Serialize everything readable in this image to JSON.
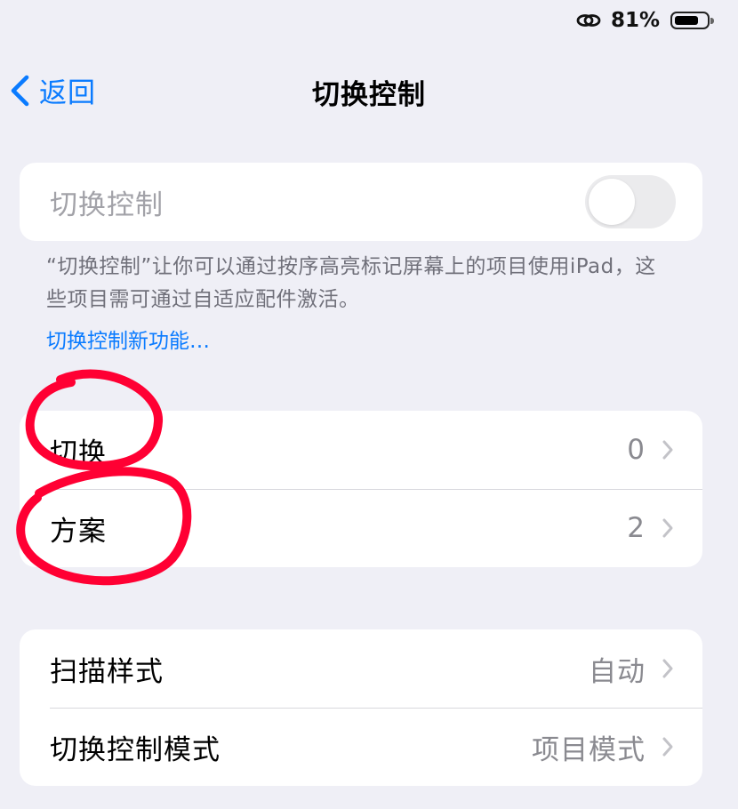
{
  "status_bar": {
    "link_icon": "link-icon",
    "battery_percent": "81%",
    "battery_level": 0.81
  },
  "nav": {
    "back_icon": "chevron-left-icon",
    "back_label": "返回",
    "title": "切换控制"
  },
  "switch_control": {
    "label": "切换控制",
    "enabled": false
  },
  "footer": {
    "description": "“切换控制”让你可以通过按序高亮标记屏幕上的项目使用iPad，这些项目需可通过自适应配件激活。",
    "link": "切换控制新功能…"
  },
  "groups": {
    "switches": {
      "items": [
        {
          "label": "切换",
          "value": "0"
        },
        {
          "label": "方案",
          "value": "2"
        }
      ]
    },
    "scan": {
      "items": [
        {
          "label": "扫描样式",
          "value": "自动"
        },
        {
          "label": "切换控制模式",
          "value": "项目模式"
        }
      ]
    }
  },
  "colors": {
    "background": "#efeff6",
    "accent": "#0a7bff",
    "annotation": "#ff0033"
  }
}
